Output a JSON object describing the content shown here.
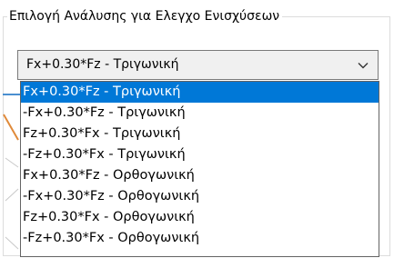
{
  "group": {
    "title": "Επιλογή Ανάλυσης για Ελεγχο Ενισχύσεων"
  },
  "combo": {
    "selected_value": "Fx+0.30*Fz - Τριγωνική",
    "arrow_icon": "chevron-down-icon"
  },
  "dropdown": {
    "highlight_color": "#0078d7",
    "selected_index": 0,
    "options": [
      "Fx+0.30*Fz - Τριγωνική",
      "-Fx+0.30*Fz - Τριγωνική",
      "Fz+0.30*Fx - Τριγωνική",
      "-Fz+0.30*Fx - Τριγωνική",
      "Fx+0.30*Fz - Ορθογωνική",
      "-Fx+0.30*Fz - Ορθογωνική",
      "Fz+0.30*Fx - Ορθογωνική",
      "-Fz+0.30*Fx - Ορθογωνική"
    ]
  }
}
